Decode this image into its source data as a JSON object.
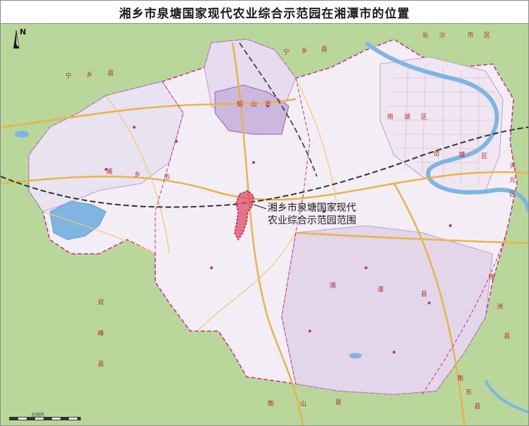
{
  "title": "湘乡市泉塘国家现代农业综合示范园在湘潭市的位置",
  "callout": {
    "line1": "湘乡市泉塘国家现代",
    "line2": "农业综合示范园范围"
  },
  "north_arrow": {
    "letter": "N",
    "icon": "north-arrow-icon"
  },
  "scale_bar": {
    "label": "比例尺"
  },
  "region_labels": {
    "ningxiang_1": "宁",
    "ningxiang_2": "乡",
    "ningxiang_3": "县",
    "changsha_1": "长",
    "changsha_2": "沙",
    "changsha_3": "市",
    "changsha_4": "区",
    "shaoshan_1": "韶",
    "shaoshan_2": "山",
    "shaoshan_3": "市",
    "xiangtan_1": "湘",
    "xiangtan_2": "潭",
    "xiangtan_3": "县",
    "xiangxiang_1": "湘",
    "xiangxiang_2": "乡",
    "xiangxiang_3": "市",
    "shuangfeng_1": "双",
    "shuangfeng_2": "峰",
    "shuangfeng_3": "县",
    "hengshan_1": "衡",
    "hengshan_2": "山",
    "hengshan_3": "县",
    "hengdong_1": "衡",
    "hengdong_2": "东",
    "hengdong_3": "县",
    "zhuzhou_1": "株",
    "zhuzhou_2": "洲",
    "zhuzhou_3": "县",
    "yuhu_1": "雨",
    "yuhu_2": "湖",
    "yuhu_3": "区",
    "yuetang_1": "岳",
    "yuetang_2": "塘",
    "yuetang_3": "区",
    "tianyuan_1": "天",
    "tianyuan_2": "元",
    "tianyuan_3": "区"
  },
  "colors": {
    "outer_land": "#b9d79a",
    "xiangtan_land": "#f3eef6",
    "district_tint": "#ddd0e6",
    "park_fill": "#e04a6a",
    "water": "#7fb5e0",
    "road_yellow": "#e8b44a",
    "railway": "#333333",
    "boundary": "#c0307f"
  }
}
